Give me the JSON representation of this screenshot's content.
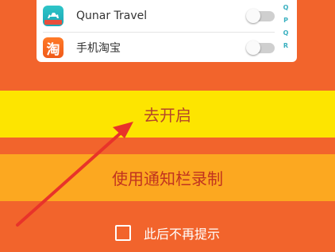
{
  "app_list": {
    "items": [
      {
        "name": "Qunar Travel",
        "icon": "camel-icon",
        "enabled": false
      },
      {
        "name": "手机淘宝",
        "icon": "taobao-icon",
        "icon_glyph": "淘",
        "enabled": false
      }
    ],
    "index_letters": [
      "Q",
      "P",
      "Q",
      "R"
    ]
  },
  "actions": {
    "open_label": "去开启",
    "notify_record_label": "使用通知栏录制"
  },
  "footer": {
    "dont_show_again_label": "此后不再提示",
    "checked": false
  },
  "colors": {
    "background": "#f2642c",
    "open_band": "#fde500",
    "notify_band": "#fca820",
    "arrow": "#e8332a"
  }
}
